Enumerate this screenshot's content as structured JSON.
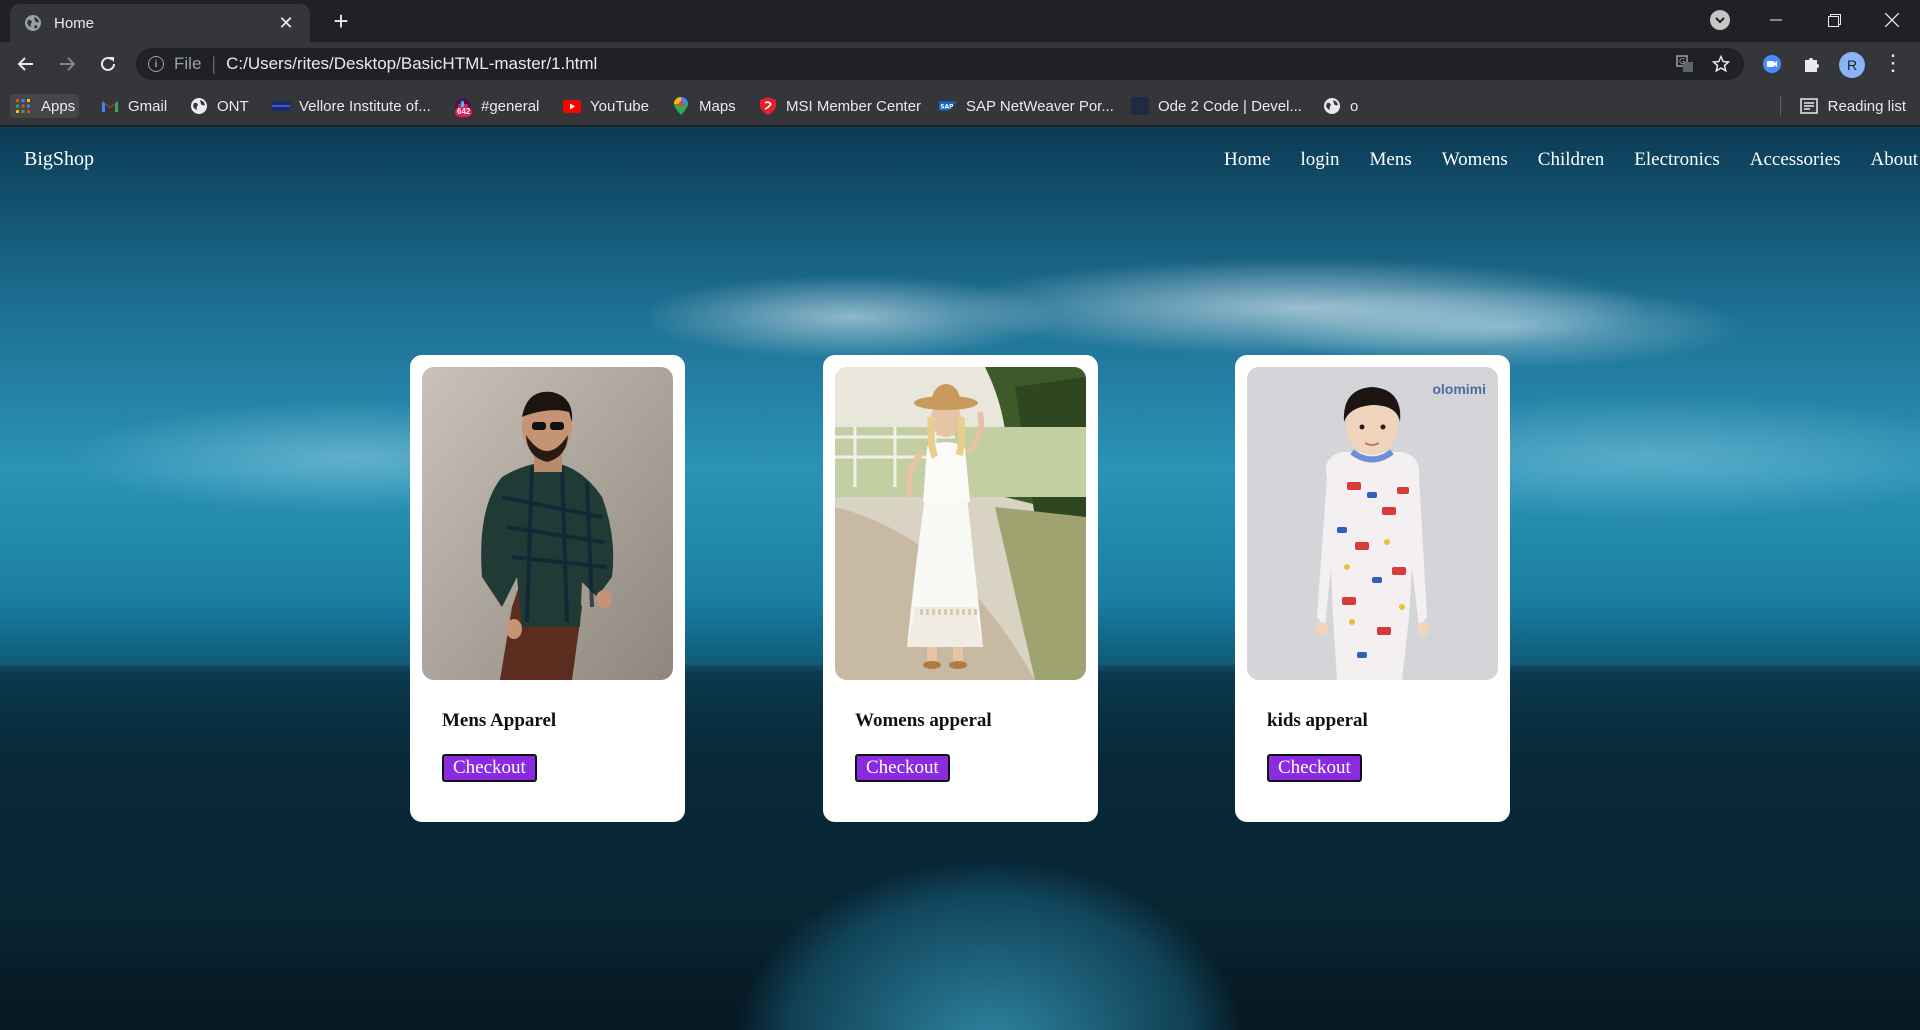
{
  "browser": {
    "tab_title": "Home",
    "url_scheme": "File",
    "url": "C:/Users/rites/Desktop/BasicHTML-master/1.html",
    "avatar_letter": "R",
    "bookmarks": [
      {
        "label": "Apps",
        "icon": "apps-grid-icon"
      },
      {
        "label": "Gmail",
        "icon": "gmail-icon"
      },
      {
        "label": "ONT",
        "icon": "globe-icon"
      },
      {
        "label": "Vellore Institute of...",
        "icon": "vit-icon"
      },
      {
        "label": "#general",
        "icon": "slack-icon",
        "badge": "642"
      },
      {
        "label": "YouTube",
        "icon": "youtube-icon"
      },
      {
        "label": "Maps",
        "icon": "maps-icon"
      },
      {
        "label": "MSI Member Center",
        "icon": "msi-icon"
      },
      {
        "label": "SAP NetWeaver Por...",
        "icon": "sap-icon"
      },
      {
        "label": "Ode 2 Code | Devel...",
        "icon": "ode2code-icon"
      },
      {
        "label": "o",
        "icon": "globe-icon"
      }
    ],
    "reading_list": "Reading list"
  },
  "site": {
    "brand": "BigShop",
    "nav": [
      "Home",
      "login",
      "Mens",
      "Womens",
      "Children",
      "Electronics",
      "Accessories",
      "About"
    ],
    "cards": [
      {
        "title": "Mens Apparel",
        "button": "Checkout",
        "image": "man-in-plaid-shirt-photo"
      },
      {
        "title": "Womens apperal",
        "button": "Checkout",
        "image": "woman-in-white-dress-photo"
      },
      {
        "title": "kids apperal",
        "button": "Checkout",
        "image": "boy-in-pajamas-photo",
        "watermark": "olomimi"
      }
    ]
  },
  "colors": {
    "checkout_button": "#8a2be2",
    "chrome_dark": "#202124",
    "chrome_toolbar": "#35363a"
  }
}
